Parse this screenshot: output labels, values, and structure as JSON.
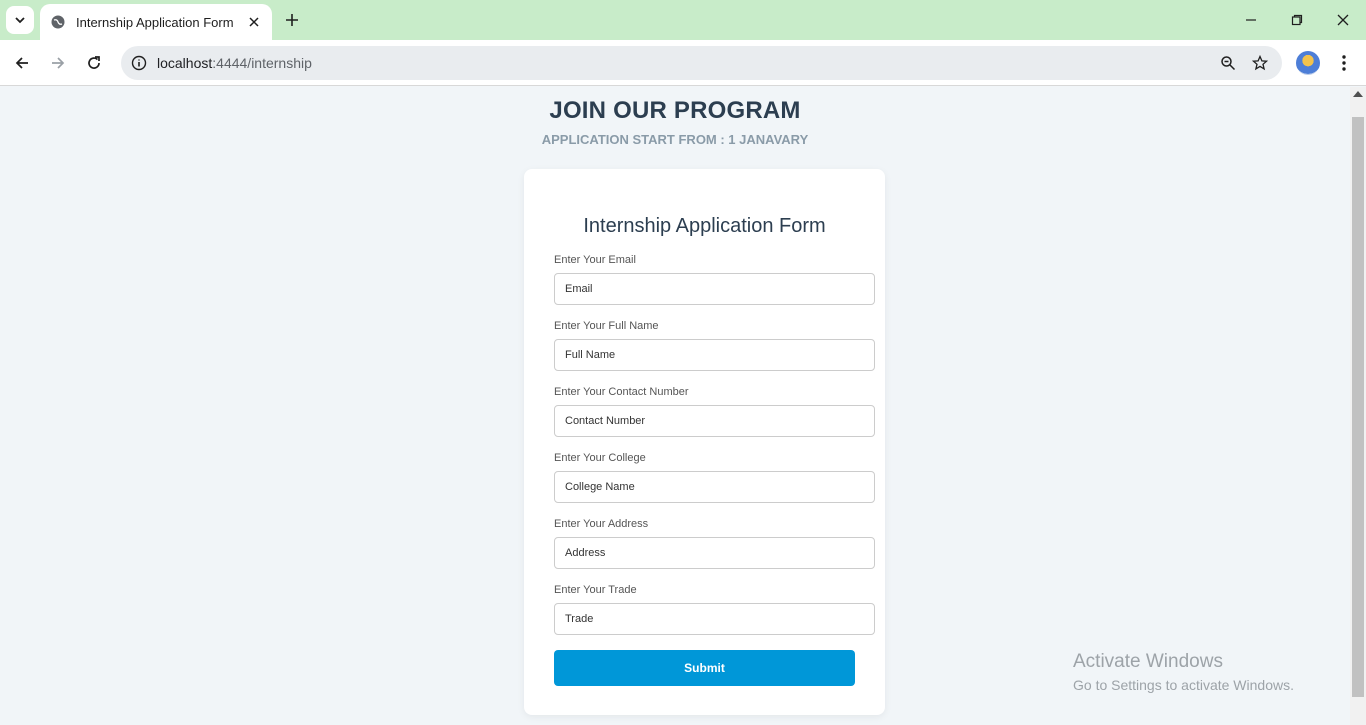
{
  "browser": {
    "tab_title": "Internship Application Form",
    "url_host": "localhost",
    "url_rest": ":4444/internship"
  },
  "hero": {
    "title": "JOIN OUR PROGRAM",
    "subtitle": "APPLICATION START FROM : 1 JANAVARY"
  },
  "form": {
    "title": "Internship Application Form",
    "fields": [
      {
        "label": "Enter Your Email",
        "placeholder": "Email"
      },
      {
        "label": "Enter Your Full Name",
        "placeholder": "Full Name"
      },
      {
        "label": "Enter Your Contact Number",
        "placeholder": "Contact Number"
      },
      {
        "label": "Enter Your College",
        "placeholder": "College Name"
      },
      {
        "label": "Enter Your Address",
        "placeholder": "Address"
      },
      {
        "label": "Enter Your Trade",
        "placeholder": "Trade"
      }
    ],
    "submit_label": "Submit"
  },
  "watermark": {
    "line1": "Activate Windows",
    "line2": "Go to Settings to activate Windows."
  },
  "colors": {
    "titlebar": "#c8ecc9",
    "page_bg": "#f1f5f8",
    "submit": "#0097d8",
    "heading": "#2c3e50"
  }
}
